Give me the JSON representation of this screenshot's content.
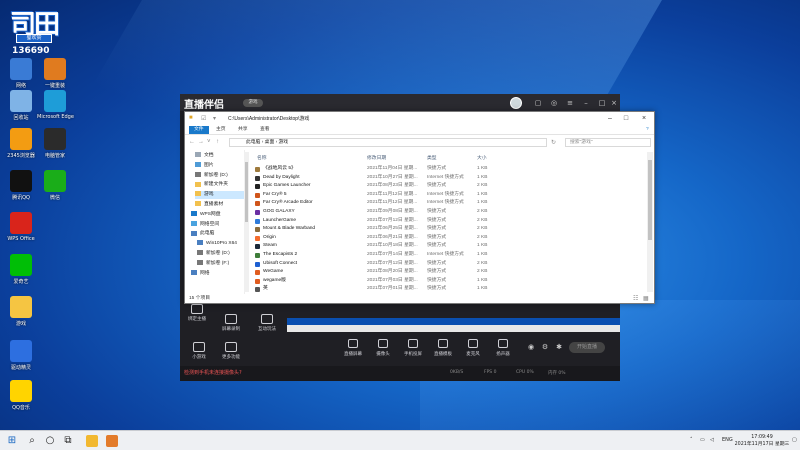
{
  "desktop": {
    "logo": {
      "title": "司田",
      "ribbon": "蜀欢赞",
      "number": "136690"
    },
    "icons": [
      {
        "label": "网络",
        "color": "#3a7bd5"
      },
      {
        "label": "一键重装",
        "color": "#e07b1f"
      },
      {
        "label": "回收站",
        "color": "#7fb3e6"
      },
      {
        "label": "Microsoft Edge",
        "color": "#1e9dd8"
      },
      {
        "label": "2345浏览器",
        "color": "#f39c12"
      },
      {
        "label": "电脑管家",
        "color": "#2b2b2b"
      },
      {
        "label": "腾讯QQ",
        "color": "#111111"
      },
      {
        "label": "微信",
        "color": "#1aad19"
      },
      {
        "label": "WPS Office",
        "color": "#d9241b"
      },
      {
        "label": "爱奇艺",
        "color": "#00be06"
      },
      {
        "label": "游戏",
        "color": "#f5c542"
      },
      {
        "label": "驱动精灵",
        "color": "#2d6fe0"
      },
      {
        "label": "QQ音乐",
        "color": "#ffd400"
      }
    ]
  },
  "streaming_app": {
    "logo": "直播伴侣",
    "top_button": "游戏",
    "left_tools": [
      "绑定主播",
      "屏幕录制",
      "互动玩法",
      "小游戏",
      "更多功能"
    ],
    "controls": [
      "直播屏幕",
      "摄像头",
      "手机投屏",
      "直播模板",
      "麦克风",
      "扬声器"
    ],
    "start_button": "开始直播",
    "warning": "检测到手机未连接摄像头?",
    "stats": [
      "0KB/S",
      "FPS 0",
      "CPU 0%",
      "内存 0%"
    ]
  },
  "explorer": {
    "path": "C:\\Users\\Administrator\\Desktop\\游戏",
    "ribbon_tabs": [
      "文件",
      "主页",
      "共享",
      "查看"
    ],
    "breadcrumb": "此电脑  ›  桌面  ›  游戏",
    "search_placeholder": "搜索\"游戏\"",
    "nav_items": [
      "文档",
      "图片",
      "新加卷 (D:)",
      "新建文件夹",
      "游戏",
      "直播素材",
      "WPS网盘",
      "网络空间",
      "此电脑",
      "Win10Pro X64",
      "新加卷 (D:)",
      "新加卷 (F:)",
      "网络"
    ],
    "columns": [
      "名称",
      "修改日期",
      "类型",
      "大小"
    ],
    "rows": [
      {
        "name": "《战地风云 5》",
        "date": "2021年11月04日 星期...",
        "type": "快捷方式",
        "size": "1 KB",
        "color": "#9e7a3c"
      },
      {
        "name": "Dead by Daylight",
        "date": "2021年10月27日 星期...",
        "type": "Internet 快捷方式",
        "size": "1 KB",
        "color": "#333333"
      },
      {
        "name": "Epic Games Launcher",
        "date": "2021年08月23日 星期...",
        "type": "快捷方式",
        "size": "2 KB",
        "color": "#222222"
      },
      {
        "name": "Far Cry® 5",
        "date": "2021年11月12日 星期...",
        "type": "Internet 快捷方式",
        "size": "1 KB",
        "color": "#d0551a"
      },
      {
        "name": "Far Cry® Arcade Editor",
        "date": "2021年11月12日 星期...",
        "type": "Internet 快捷方式",
        "size": "1 KB",
        "color": "#d0551a"
      },
      {
        "name": "GOG GALAXY",
        "date": "2021年09月08日 星期...",
        "type": "快捷方式",
        "size": "2 KB",
        "color": "#6b2fa3"
      },
      {
        "name": "LauncherGame",
        "date": "2021年07月12日 星期...",
        "type": "快捷方式",
        "size": "2 KB",
        "color": "#2f7bd9"
      },
      {
        "name": "Mount & Blade Warband",
        "date": "2021年06月25日 星期...",
        "type": "快捷方式",
        "size": "2 KB",
        "color": "#8a6b3a"
      },
      {
        "name": "Origin",
        "date": "2021年06月21日 星期...",
        "type": "快捷方式",
        "size": "2 KB",
        "color": "#f56c2d"
      },
      {
        "name": "Steam",
        "date": "2021年10月18日 星期...",
        "type": "快捷方式",
        "size": "1 KB",
        "color": "#1b2838"
      },
      {
        "name": "The Escapists 2",
        "date": "2021年07月14日 星期...",
        "type": "Internet 快捷方式",
        "size": "1 KB",
        "color": "#3f7d3a"
      },
      {
        "name": "Ubisoft Connect",
        "date": "2021年07月12日 星期...",
        "type": "快捷方式",
        "size": "2 KB",
        "color": "#1d5fd1"
      },
      {
        "name": "WeGame",
        "date": "2021年08月20日 星期...",
        "type": "快捷方式",
        "size": "2 KB",
        "color": "#e05c1f"
      },
      {
        "name": "wegame版",
        "date": "2021年07月03日 星期...",
        "type": "快捷方式",
        "size": "1 KB",
        "color": "#e05c1f"
      },
      {
        "name": "英",
        "date": "2021年07月01日 星期...",
        "type": "快捷方式",
        "size": "1 KB",
        "color": "#555555"
      }
    ],
    "status": "15 个项目"
  },
  "taskbar": {
    "tray": "ENG",
    "time": "17:09:49",
    "date": "2021年11月17日 星期三"
  }
}
